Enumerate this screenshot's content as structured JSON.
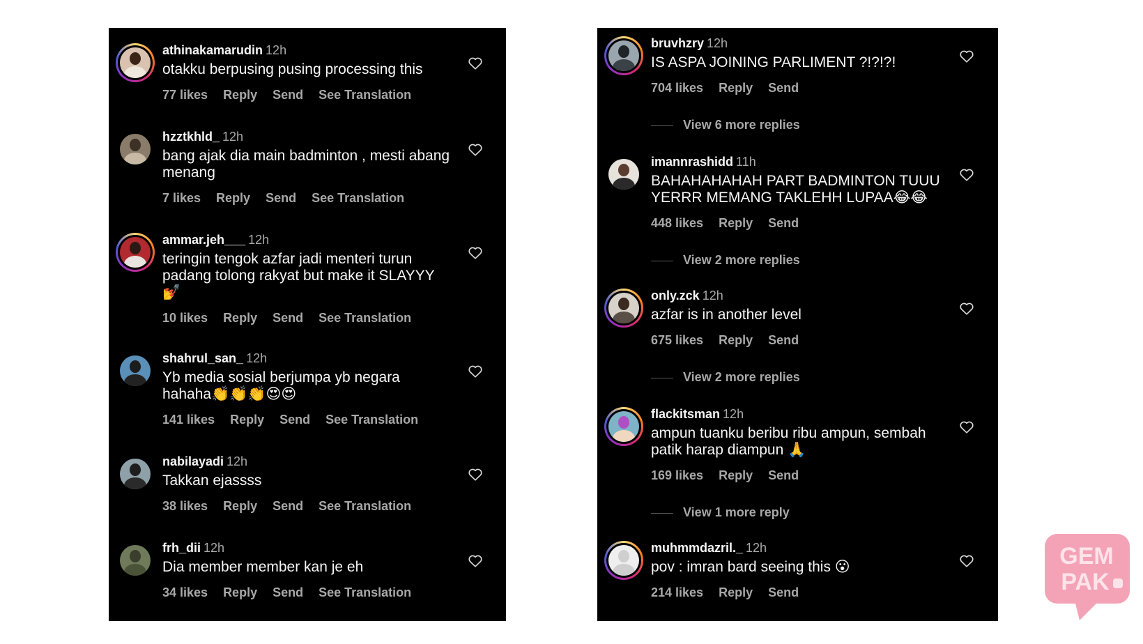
{
  "left_panel": {
    "comments": [
      {
        "username": "athinakamarudin",
        "time": "12h",
        "text": "otakku berpusing pusing processing this",
        "likes": "77 likes",
        "reply": "Reply",
        "send": "Send",
        "translate": "See Translation"
      },
      {
        "username": "hzztkhld_",
        "time": "12h",
        "text": "bang ajak dia main badminton , mesti abang menang",
        "likes": "7 likes",
        "reply": "Reply",
        "send": "Send",
        "translate": "See Translation"
      },
      {
        "username": "ammar.jeh___",
        "time": "12h",
        "text": "teringin tengok azfar jadi menteri turun padang tolong rakyat but make it SLAYYY 💅",
        "likes": "10 likes",
        "reply": "Reply",
        "send": "Send",
        "translate": "See Translation"
      },
      {
        "username": "shahrul_san_",
        "time": "12h",
        "text": "Yb media sosial berjumpa yb negara hahaha👏👏👏😍😍",
        "likes": "141 likes",
        "reply": "Reply",
        "send": "Send",
        "translate": "See Translation"
      },
      {
        "username": "nabilayadi",
        "time": "12h",
        "text": "Takkan ejassss",
        "likes": "38 likes",
        "reply": "Reply",
        "send": "Send",
        "translate": "See Translation"
      },
      {
        "username": "frh_dii",
        "time": "12h",
        "text": "Dia member member kan je eh",
        "likes": "34 likes",
        "reply": "Reply",
        "send": "Send",
        "translate": "See Translation"
      }
    ]
  },
  "right_panel": {
    "comments": [
      {
        "username": "bruvhzry",
        "time": "12h",
        "text": "IS ASPA JOINING PARLIMENT ?!?!?!",
        "likes": "704 likes",
        "reply": "Reply",
        "send": "Send",
        "view_more": "View 6 more replies"
      },
      {
        "username": "imannrashidd",
        "time": "11h",
        "text": "BAHAHAHAHAH PART BADMINTON TUUU YERRR MEMANG TAKLEHH LUPAA😂😂",
        "likes": "448 likes",
        "reply": "Reply",
        "send": "Send",
        "view_more": "View 2 more replies"
      },
      {
        "username": "only.zck",
        "time": "12h",
        "text": "azfar is in another level",
        "likes": "675 likes",
        "reply": "Reply",
        "send": "Send",
        "view_more": "View 2 more replies"
      },
      {
        "username": "flackitsman",
        "time": "12h",
        "text": "ampun tuanku beribu ribu ampun, sembah patik harap diampun 🙏",
        "likes": "169 likes",
        "reply": "Reply",
        "send": "Send",
        "view_more": "View 1 more reply"
      },
      {
        "username": "muhmmdazril._",
        "time": "12h",
        "text": "pov : imran bard seeing this 😮",
        "likes": "214 likes",
        "reply": "Reply",
        "send": "Send"
      }
    ]
  },
  "watermark": {
    "line1": "GEM",
    "line2": "PAK"
  },
  "colors": {
    "panel_bg": "#000000",
    "primary_text": "#f5f5f5",
    "secondary_text": "#a8a8a8",
    "logo_pink": "#f4a3b7"
  }
}
